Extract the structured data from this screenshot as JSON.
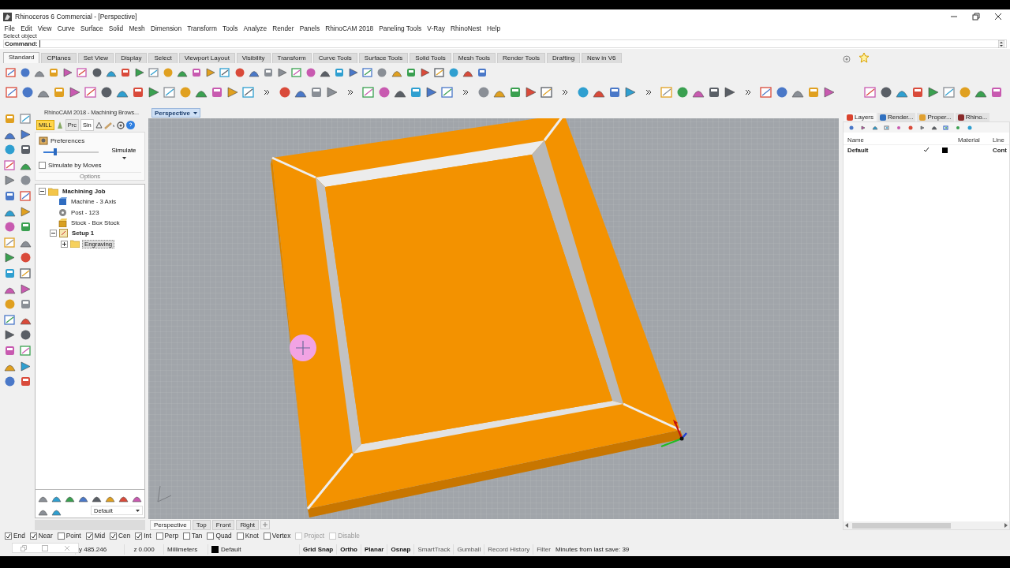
{
  "window": {
    "title": "Rhinoceros 6 Commercial - [Perspective]"
  },
  "menu": [
    "File",
    "Edit",
    "View",
    "Curve",
    "Surface",
    "Solid",
    "Mesh",
    "Dimension",
    "Transform",
    "Tools",
    "Analyze",
    "Render",
    "Panels",
    "RhinoCAM 2018",
    "Paneling Tools",
    "V-Ray",
    "RhinoNest",
    "Help"
  ],
  "command": {
    "history": "Select object",
    "label": "Command:"
  },
  "toolbar_tabs": [
    {
      "label": "Standard",
      "selected": true
    },
    {
      "label": "CPlanes",
      "selected": false
    },
    {
      "label": "Set View",
      "selected": false
    },
    {
      "label": "Display",
      "selected": false
    },
    {
      "label": "Select",
      "selected": false
    },
    {
      "label": "Viewport Layout",
      "selected": false
    },
    {
      "label": "Visibility",
      "selected": false
    },
    {
      "label": "Transform",
      "selected": false
    },
    {
      "label": "Curve Tools",
      "selected": false
    },
    {
      "label": "Surface Tools",
      "selected": false
    },
    {
      "label": "Solid Tools",
      "selected": false
    },
    {
      "label": "Mesh Tools",
      "selected": false
    },
    {
      "label": "Render Tools",
      "selected": false
    },
    {
      "label": "Drafting",
      "selected": false
    },
    {
      "label": "New in V6",
      "selected": false
    }
  ],
  "left_panel": {
    "title": "RhinoCAM 2018 - Machining Brows...",
    "tabs": [
      {
        "label": "MILL",
        "kind": "module",
        "selected": true
      },
      {
        "label": "Prc",
        "kind": "tab",
        "selected": false
      },
      {
        "label": "Sin",
        "kind": "tab",
        "selected": true
      }
    ],
    "preferences": "Preferences",
    "speed": {
      "level": 0.22
    },
    "simulate_by_moves": {
      "label": "Simulate by Moves",
      "checked": false
    },
    "simulate": "Simulate",
    "group_label": "Options",
    "tree": [
      {
        "label": "Machining Job",
        "kind": "job",
        "expanded": true,
        "selected": false,
        "children": [
          {
            "label": "Machine - 3 Axis",
            "kind": "machine",
            "selected": false
          },
          {
            "label": "Post - 123",
            "kind": "post",
            "selected": false
          },
          {
            "label": "Stock - Box Stock",
            "kind": "stock",
            "selected": false
          },
          {
            "label": "Setup 1",
            "kind": "setup",
            "expanded": true,
            "selected": false,
            "children": [
              {
                "label": "Engraving",
                "kind": "folder",
                "expanded": false,
                "selected": true
              }
            ]
          }
        ]
      }
    ],
    "dropdown": "Default"
  },
  "viewport": {
    "title": "Perspective"
  },
  "viewport_tabs": [
    {
      "label": "Perspective",
      "selected": true
    },
    {
      "label": "Top",
      "selected": false
    },
    {
      "label": "Front",
      "selected": false
    },
    {
      "label": "Right",
      "selected": false
    }
  ],
  "right_panel": {
    "tabs": [
      {
        "label": "Layers",
        "selected": true
      },
      {
        "label": "Render...",
        "selected": false
      },
      {
        "label": "Proper...",
        "selected": false
      },
      {
        "label": "Rhino...",
        "selected": false
      }
    ],
    "columns": [
      "Name",
      "Material",
      "Line"
    ],
    "rows": [
      {
        "name": "Default",
        "visible": true,
        "color": "#000000",
        "linetype": "Cont"
      }
    ]
  },
  "osnaps": [
    {
      "label": "End",
      "checked": true,
      "disabled": false
    },
    {
      "label": "Near",
      "checked": true,
      "disabled": false
    },
    {
      "label": "Point",
      "checked": false,
      "disabled": false
    },
    {
      "label": "Mid",
      "checked": true,
      "disabled": false
    },
    {
      "label": "Cen",
      "checked": true,
      "disabled": false
    },
    {
      "label": "Int",
      "checked": true,
      "disabled": false
    },
    {
      "label": "Perp",
      "checked": false,
      "disabled": false
    },
    {
      "label": "Tan",
      "checked": false,
      "disabled": false
    },
    {
      "label": "Quad",
      "checked": false,
      "disabled": false
    },
    {
      "label": "Knot",
      "checked": false,
      "disabled": false
    },
    {
      "label": "Vertex",
      "checked": false,
      "disabled": false
    },
    {
      "label": "Project",
      "checked": false,
      "disabled": true
    },
    {
      "label": "Disable",
      "checked": false,
      "disabled": true
    }
  ],
  "status_bar": {
    "y": "y 485.246",
    "z": "z 0.000",
    "units": "Millimeters",
    "layer": "Default",
    "toggles": [
      {
        "label": "Grid Snap",
        "on": true
      },
      {
        "label": "Ortho",
        "on": true
      },
      {
        "label": "Planar",
        "on": true
      },
      {
        "label": "Osnap",
        "on": true
      },
      {
        "label": "SmartTrack",
        "on": false
      },
      {
        "label": "Gumball",
        "on": false
      },
      {
        "label": "Record History",
        "on": false
      }
    ],
    "filter": "Filter",
    "save_info": "Minutes from last save: 39"
  }
}
